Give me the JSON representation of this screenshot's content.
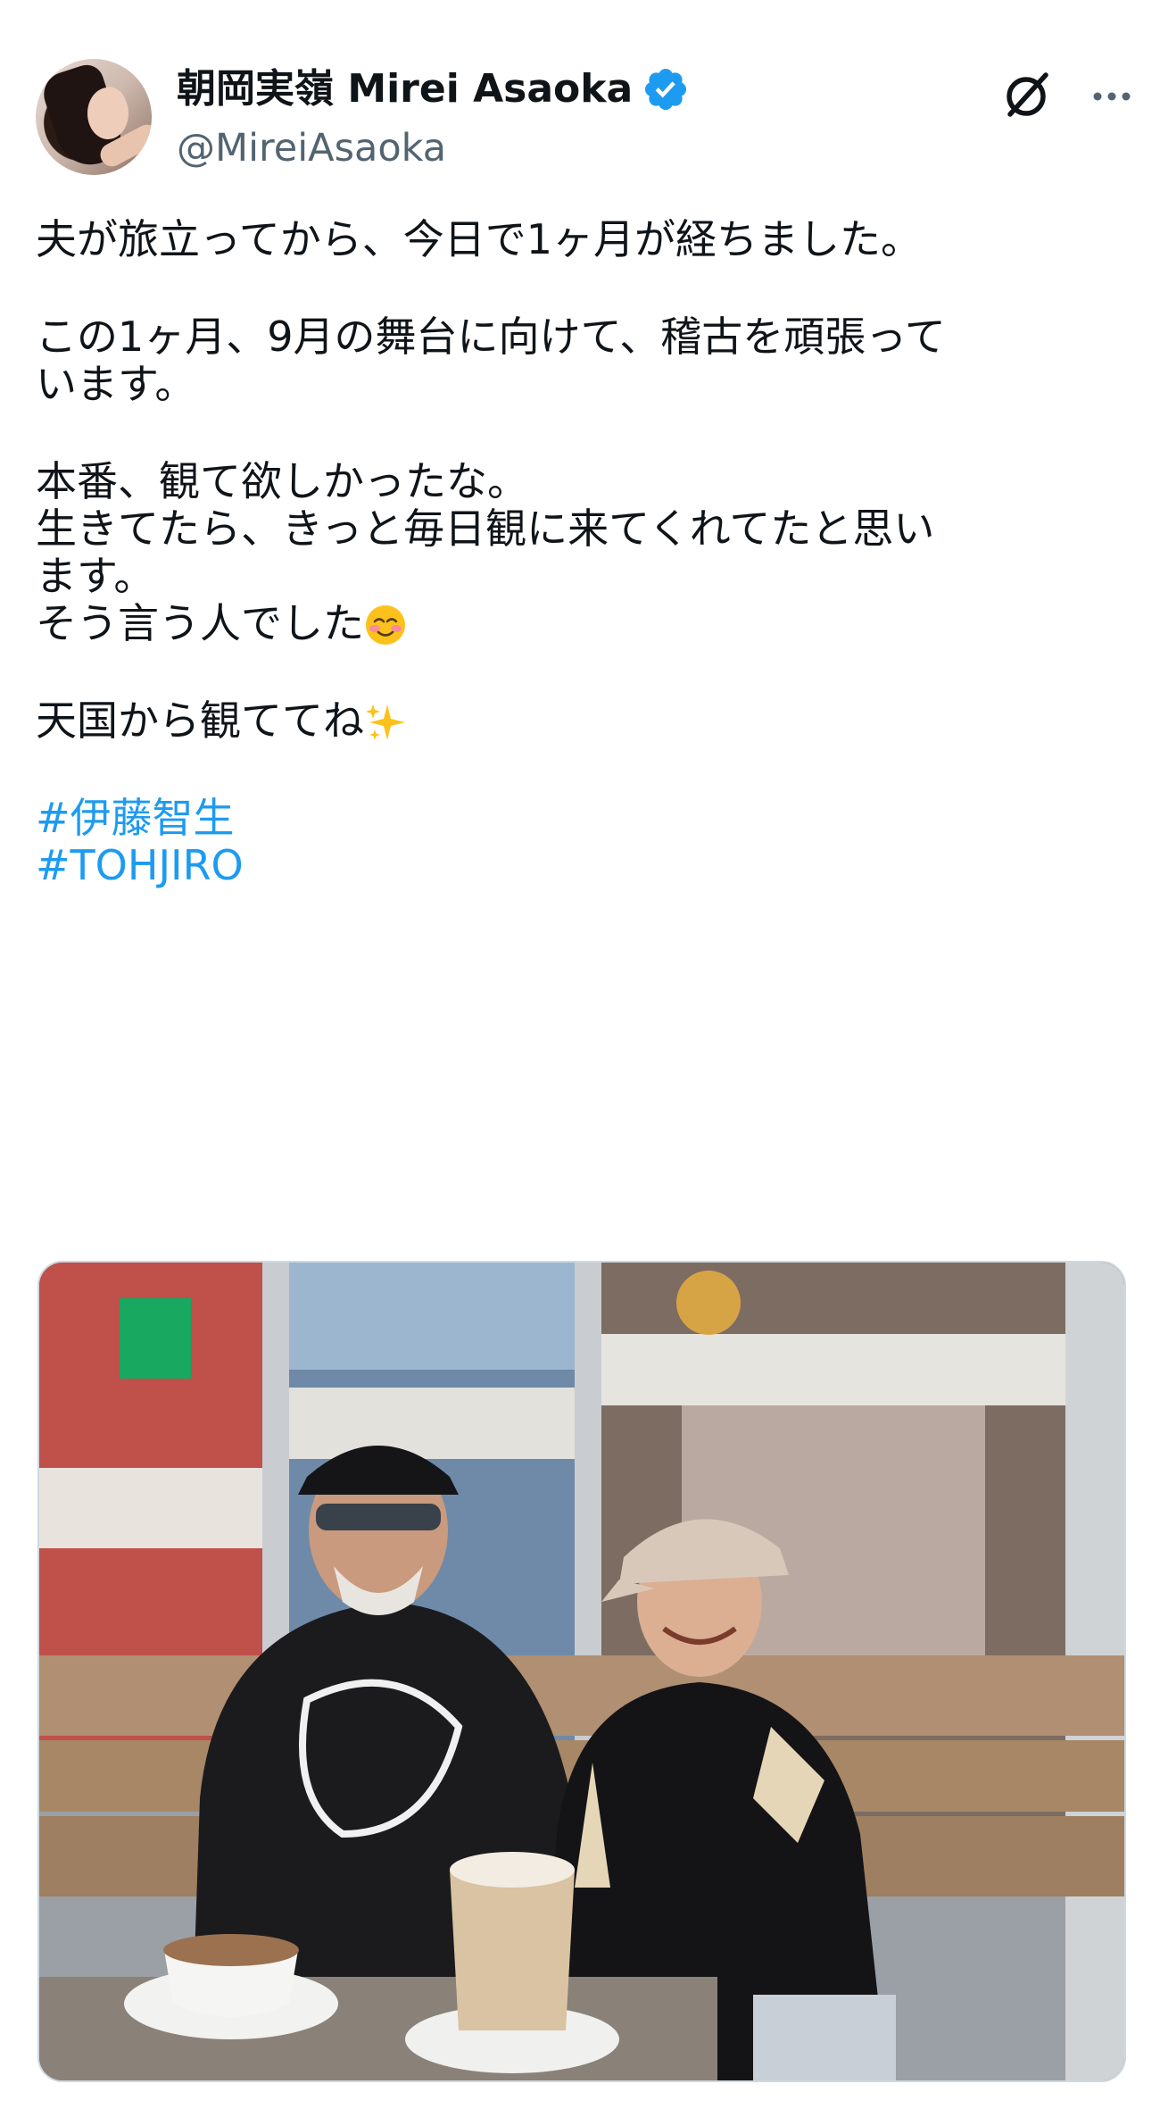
{
  "author": {
    "display_name": "朝岡実嶺 Mirei Asaoka",
    "handle": "@MireiAsaoka",
    "verified": true,
    "verified_color": "#1d9bf0"
  },
  "icons": {
    "verified": "verified-badge-icon",
    "grok": "grok-icon",
    "more": "more-options-icon"
  },
  "tweet": {
    "paragraphs": [
      [
        "夫が旅立ってから、今日で1ヶ月が経ちました。"
      ],
      [
        "この1ヶ月、9月の舞台に向けて、稽古を頑張って",
        "います。"
      ],
      [
        "本番、観て欲しかったな。",
        "生きてたら、きっと毎日観に来てくれてたと思い",
        "ます。",
        "そう言う人でした"
      ],
      [
        "天国から観ててね"
      ]
    ],
    "emoji_smiling": "smiling-face-blush-emoji",
    "emoji_sparkles": "sparkles-emoji",
    "hashtags": [
      "#伊藤智生",
      "#TOHJIRO"
    ],
    "hashtag_color": "#1d9bf0"
  },
  "media": {
    "kind": "photo",
    "alt": "photo"
  }
}
